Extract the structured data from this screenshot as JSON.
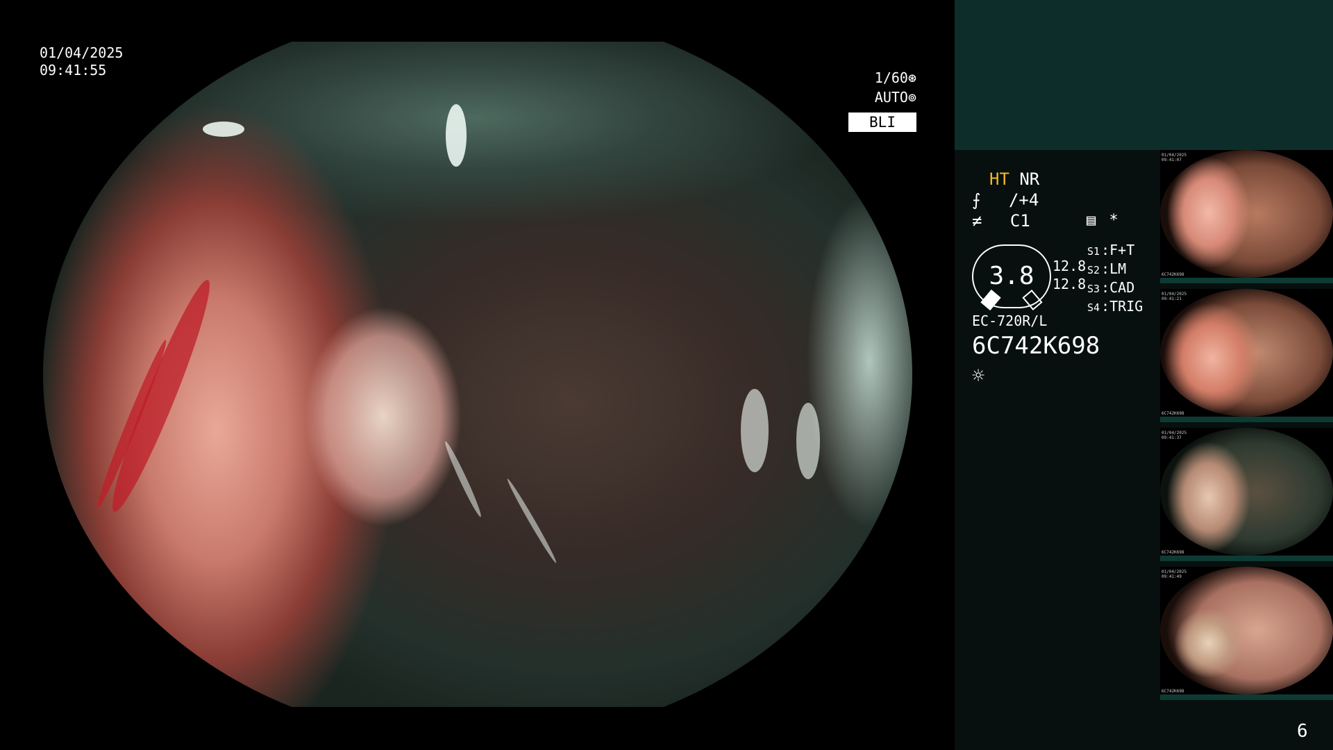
{
  "overlay": {
    "date": "01/04/2025",
    "time": "09:41:55",
    "shutter": "1/60",
    "shutter_icon": "shutter-icon",
    "iris_mode": "AUTO",
    "iris_icon": "iris-icon",
    "light_mode": "BLI"
  },
  "panel": {
    "ht": "HT",
    "nr": "NR",
    "enhance_value": "/+4",
    "color_value": "C1",
    "record_symbol": "*",
    "zoom_value": "3.8",
    "scale_top": "12.8",
    "scale_bottom": "12.8",
    "switches": [
      {
        "key": "S1",
        "value": "F+T"
      },
      {
        "key": "S2",
        "value": "LM"
      },
      {
        "key": "S3",
        "value": "CAD"
      },
      {
        "key": "S4",
        "value": "TRIG"
      }
    ],
    "scope_model": "EC-720R/L",
    "scope_serial": "6C742K698"
  },
  "thumbnails": [
    {
      "top_left": "01/04/2025\n09:41:07",
      "bottom_left": "6C742K698"
    },
    {
      "top_left": "01/04/2025\n09:41:21",
      "bottom_left": "6C742K698"
    },
    {
      "top_left": "01/04/2025\n09:41:37",
      "bottom_left": "6C742K698"
    },
    {
      "top_left": "01/04/2025\n09:41:49",
      "bottom_left": "6C742K698"
    }
  ],
  "page_number": "6",
  "colors": {
    "background": "#000000",
    "panel_header": "#0d2d2b",
    "panel_body": "#07100e",
    "ht_accent": "#f5b820",
    "thumb_bar": "#0e3a34"
  }
}
